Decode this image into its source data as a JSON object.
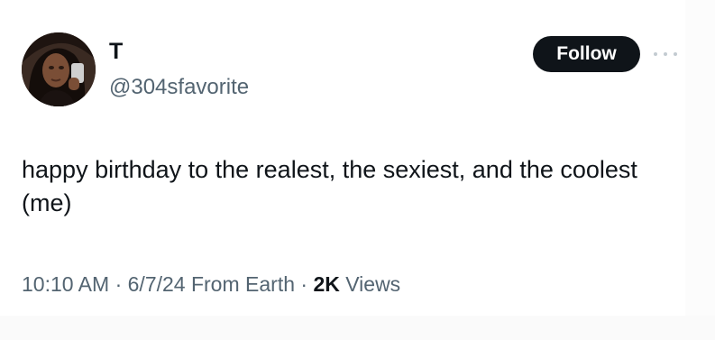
{
  "user": {
    "display_name": "T",
    "handle": "@304sfavorite",
    "avatar_icon": "profile-photo"
  },
  "actions": {
    "follow_label": "Follow",
    "more_icon": "more-dots-icon"
  },
  "tweet": {
    "text": "happy birthday to the realest, the sexiest, and the coolest (me)",
    "time": "10:10 AM",
    "separator": "·",
    "date_source": "6/7/24 From Earth",
    "views_count": "2K",
    "views_label": "Views"
  },
  "colors": {
    "text_primary": "#0f1419",
    "text_secondary": "#536471",
    "button_bg": "#0f1419",
    "button_text": "#ffffff"
  }
}
